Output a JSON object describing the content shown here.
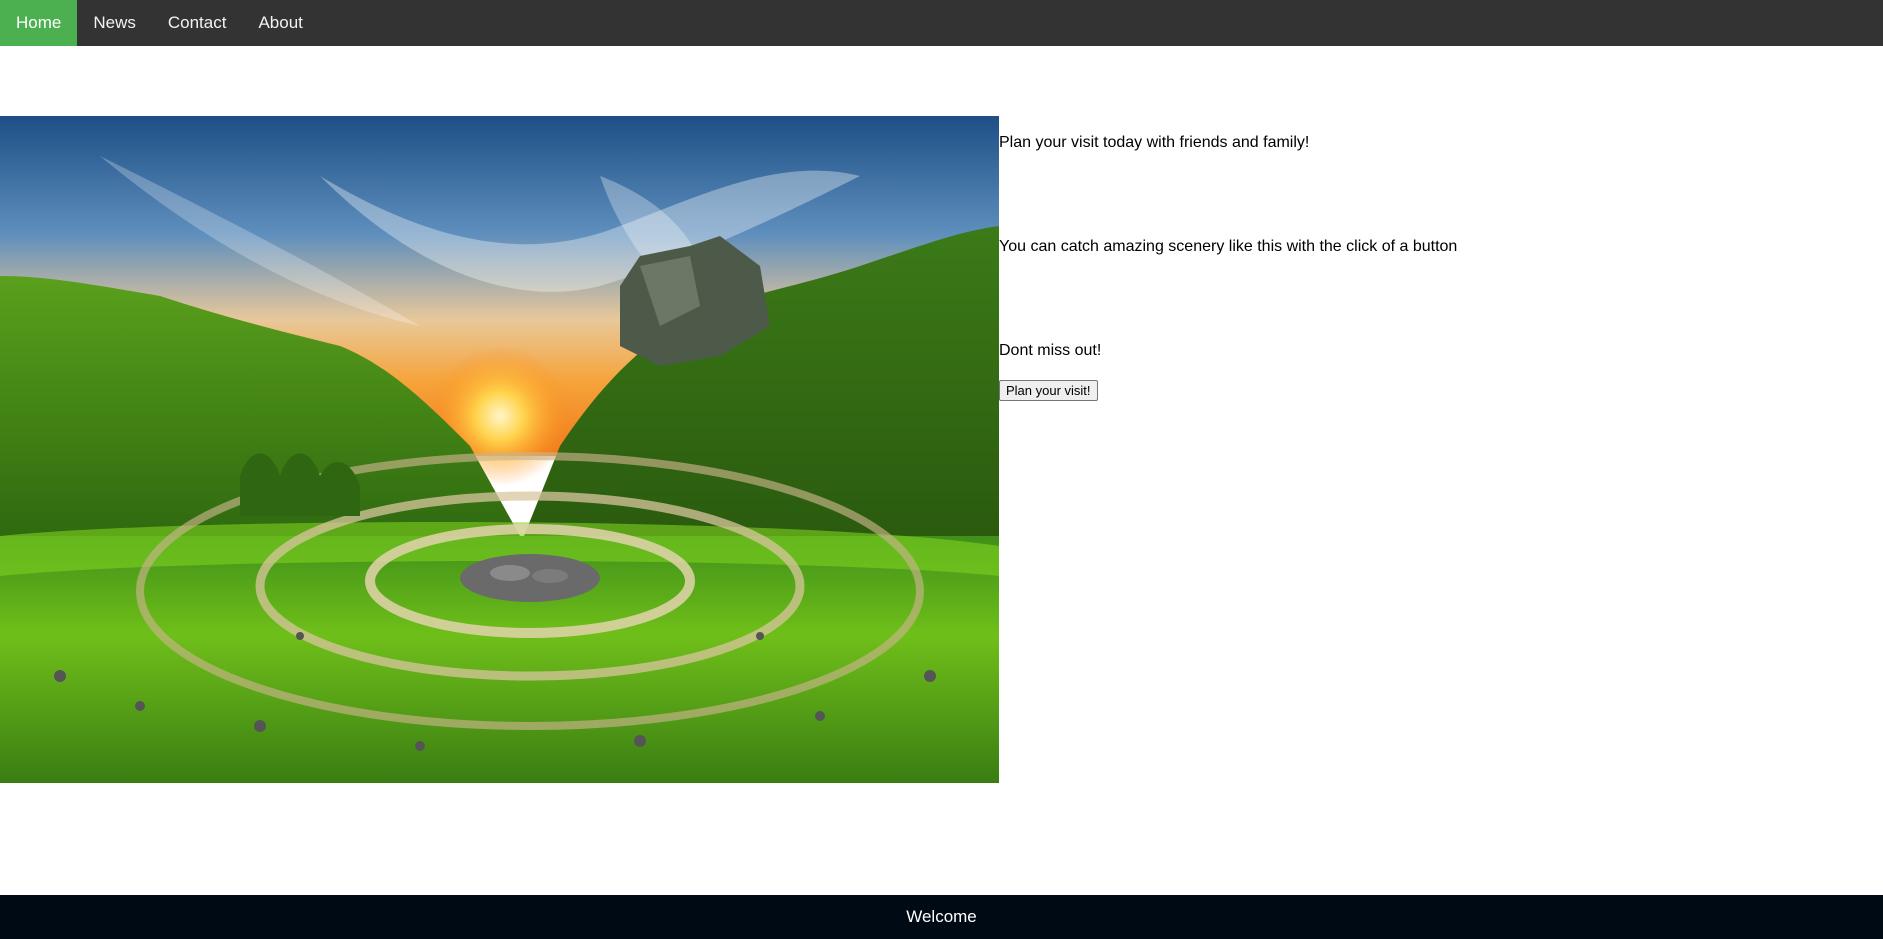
{
  "nav": {
    "items": [
      {
        "label": "Home",
        "active": true
      },
      {
        "label": "News",
        "active": false
      },
      {
        "label": "Contact",
        "active": false
      },
      {
        "label": "About",
        "active": false
      }
    ],
    "background": "#333333",
    "active_color": "#4caf50"
  },
  "main": {
    "lines": [
      "Plan your visit today with friends and family!",
      "You can catch amazing scenery like this with the click of a button",
      "Dont miss out!"
    ],
    "button_label": "Plan your visit!"
  },
  "footer": {
    "text": "Welcome",
    "background": "#000a14"
  }
}
